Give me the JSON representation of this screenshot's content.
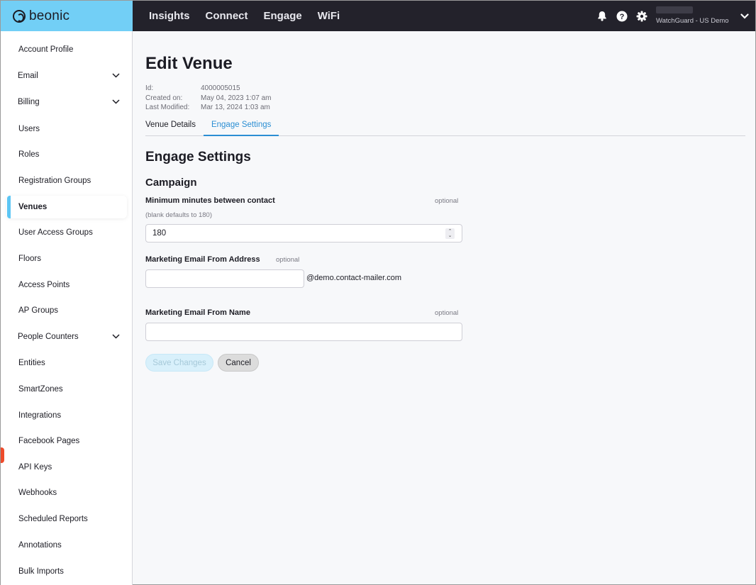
{
  "brand": {
    "name": "beonic"
  },
  "nav": {
    "items": [
      "Insights",
      "Connect",
      "Engage",
      "WiFi"
    ]
  },
  "header": {
    "org_name": "WatchGuard - US Demo",
    "icons": [
      "bell-icon",
      "help-icon",
      "gear-icon",
      "chevron-down-icon"
    ]
  },
  "sidebar": {
    "items": [
      {
        "label": "Account Profile",
        "expandable": false
      },
      {
        "label": "Email",
        "expandable": true
      },
      {
        "label": "Billing",
        "expandable": true
      },
      {
        "label": "Users",
        "expandable": false
      },
      {
        "label": "Roles",
        "expandable": false
      },
      {
        "label": "Registration Groups",
        "expandable": false
      },
      {
        "label": "Venues",
        "expandable": false,
        "active": true
      },
      {
        "label": "User Access Groups",
        "expandable": false
      },
      {
        "label": "Floors",
        "expandable": false
      },
      {
        "label": "Access Points",
        "expandable": false
      },
      {
        "label": "AP Groups",
        "expandable": false
      },
      {
        "label": "People Counters",
        "expandable": true
      },
      {
        "label": "Entities",
        "expandable": false
      },
      {
        "label": "SmartZones",
        "expandable": false
      },
      {
        "label": "Integrations",
        "expandable": false
      },
      {
        "label": "Facebook Pages",
        "expandable": false
      },
      {
        "label": "API Keys",
        "expandable": false
      },
      {
        "label": "Webhooks",
        "expandable": false
      },
      {
        "label": "Scheduled Reports",
        "expandable": false
      },
      {
        "label": "Annotations",
        "expandable": false
      },
      {
        "label": "Bulk Imports",
        "expandable": false
      }
    ]
  },
  "page": {
    "title": "Edit Venue",
    "meta": [
      {
        "key": "Id:",
        "value": "4000005015"
      },
      {
        "key": "Created on:",
        "value": "May 04, 2023 1:07 am"
      },
      {
        "key": "Last Modified:",
        "value": "Mar 13, 2024 1:03 am"
      }
    ],
    "tabs": [
      {
        "label": "Venue Details",
        "active": false
      },
      {
        "label": "Engage Settings",
        "active": true
      }
    ],
    "section_title": "Engage Settings",
    "subsection_title": "Campaign",
    "fields": {
      "min_minutes": {
        "label": "Minimum minutes between contact",
        "optional": "optional",
        "hint": "(blank defaults to 180)",
        "value": "180"
      },
      "from_address": {
        "label": "Marketing Email From Address",
        "optional": "optional",
        "value": "",
        "suffix": "@demo.contact-mailer.com"
      },
      "from_name": {
        "label": "Marketing Email From Name",
        "optional": "optional",
        "value": ""
      }
    },
    "buttons": {
      "save": "Save Changes",
      "cancel": "Cancel"
    }
  },
  "colors": {
    "brand": "#72cff6",
    "topbar": "#23222b",
    "accent": "#2b8ed3",
    "active_indicator": "#5cc6f4",
    "alert": "#ee4b2b"
  }
}
